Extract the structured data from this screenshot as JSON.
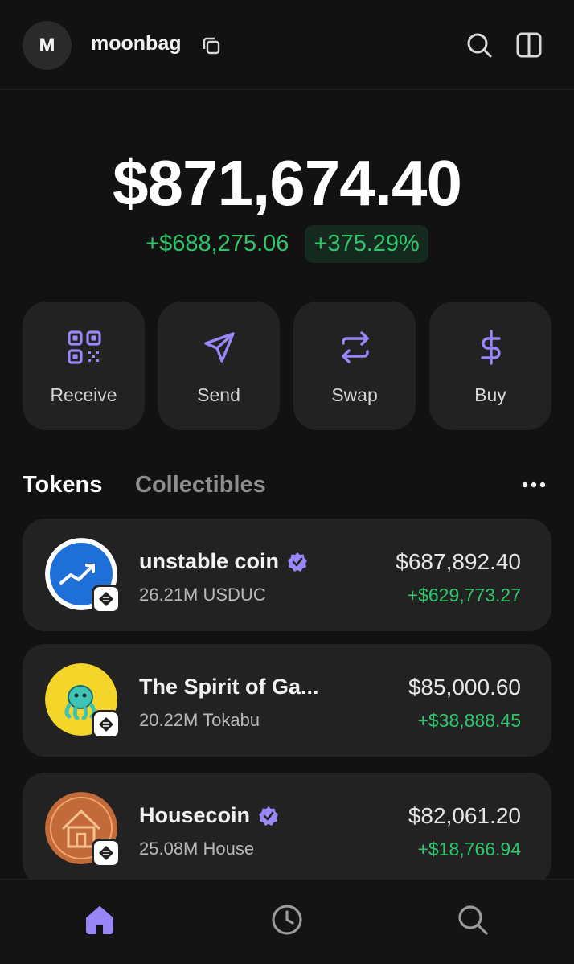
{
  "header": {
    "avatar_letter": "M",
    "account_name": "moonbag"
  },
  "balance": {
    "total": "$871,674.40",
    "change_abs": "+$688,275.06",
    "change_pct": "+375.29%"
  },
  "actions": [
    {
      "label": "Receive",
      "icon": "qr-code-icon"
    },
    {
      "label": "Send",
      "icon": "send-icon"
    },
    {
      "label": "Swap",
      "icon": "swap-icon"
    },
    {
      "label": "Buy",
      "icon": "dollar-icon"
    }
  ],
  "tabs": {
    "tokens": "Tokens",
    "collectibles": "Collectibles"
  },
  "tokens": [
    {
      "name": "unstable coin",
      "amount": "26.21M USDUC",
      "value": "$687,892.40",
      "change": "+$629,773.27",
      "verified": true
    },
    {
      "name": "The Spirit of Ga...",
      "amount": "20.22M Tokabu",
      "value": "$85,000.60",
      "change": "+$38,888.45",
      "verified": false
    },
    {
      "name": "Housecoin",
      "amount": "25.08M House",
      "value": "$82,061.20",
      "change": "+$18,766.94",
      "verified": true
    }
  ],
  "colors": {
    "background": "#121212",
    "card": "#222222",
    "accent": "#9b86f7",
    "positive": "#2fc66b"
  }
}
